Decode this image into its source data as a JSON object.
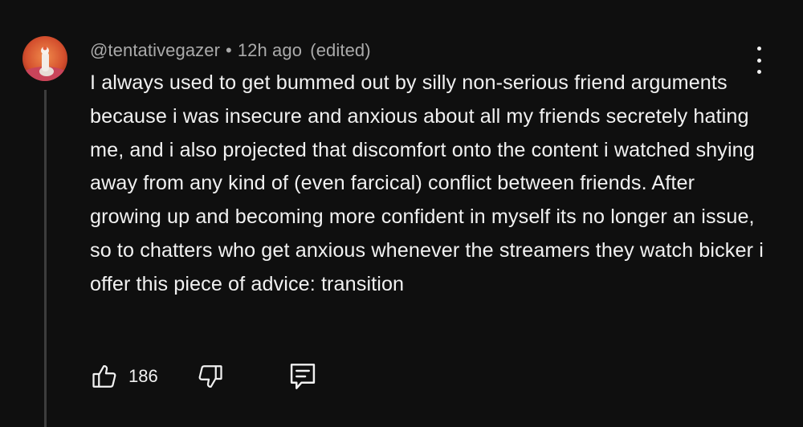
{
  "comment": {
    "username": "@tentativegazer",
    "separator": "•",
    "timestamp": "12h ago",
    "edited_label": "(edited)",
    "text": "I always used to get bummed out by silly non-serious friend arguments because i was insecure and anxious about all my friends secretely hating me, and i also projected that discomfort onto the content i watched shying away from any kind of (even farcical) conflict between friends. After growing up and becoming more confident in myself its no longer an issue, so to chatters who get anxious whenever the streamers they watch bicker i offer this piece of advice: transition",
    "like_count": "186"
  },
  "icons": {
    "avatar": "avatar-image",
    "menu": "more-vert-icon",
    "like": "thumbs-up-icon",
    "dislike": "thumbs-down-icon",
    "reply": "reply-comment-icon"
  },
  "colors": {
    "background": "#0f0f0f",
    "text": "#f1f1f1",
    "secondary_text": "#aaaaaa",
    "thread_line": "#3d3d3d"
  }
}
